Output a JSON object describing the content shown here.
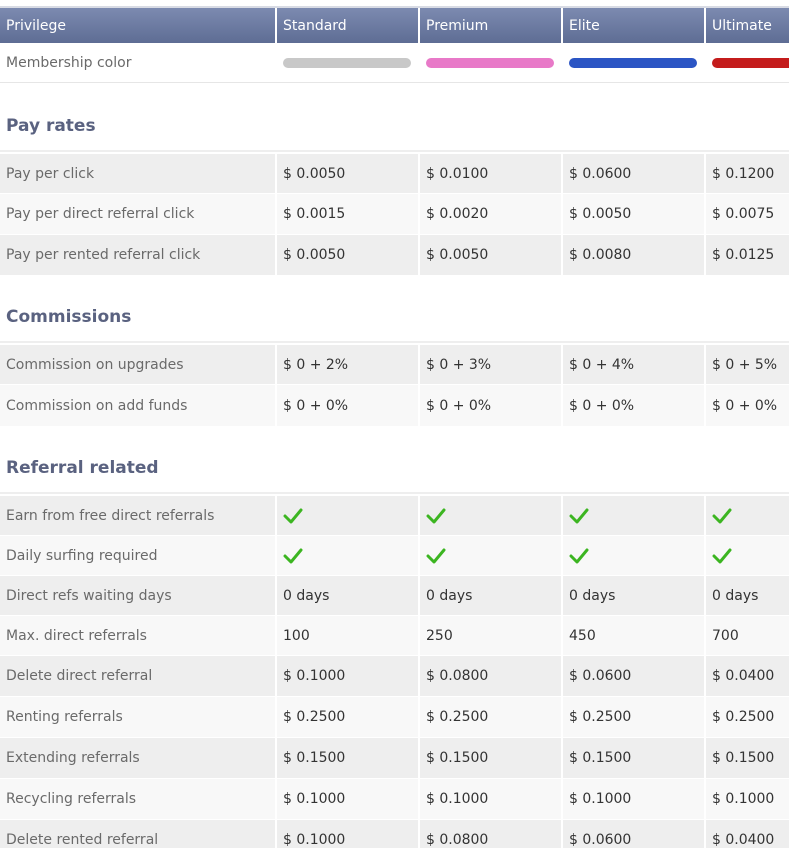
{
  "header": {
    "columns": [
      "Privilege",
      "Standard",
      "Premium",
      "Elite",
      "Ultimate"
    ]
  },
  "membership_color": {
    "label": "Membership color",
    "colors": [
      "#c8c8c8",
      "#e879c8",
      "#2b55c4",
      "#c41c1c"
    ]
  },
  "sections": {
    "pay_rates": {
      "title": "Pay rates",
      "rows": [
        {
          "label": "Pay per click",
          "values": [
            "$ 0.0050",
            "$ 0.0100",
            "$ 0.0600",
            "$ 0.1200"
          ]
        },
        {
          "label": "Pay per direct referral click",
          "values": [
            "$ 0.0015",
            "$ 0.0020",
            "$ 0.0050",
            "$ 0.0075"
          ]
        },
        {
          "label": "Pay per rented referral click",
          "values": [
            "$ 0.0050",
            "$ 0.0050",
            "$ 0.0080",
            "$ 0.0125"
          ]
        }
      ]
    },
    "commissions": {
      "title": "Commissions",
      "rows": [
        {
          "label": "Commission on upgrades",
          "values": [
            "$ 0 + 2%",
            "$ 0 + 3%",
            "$ 0 + 4%",
            "$ 0 + 5%"
          ]
        },
        {
          "label": "Commission on add funds",
          "values": [
            "$ 0 + 0%",
            "$ 0 + 0%",
            "$ 0 + 0%",
            "$ 0 + 0%"
          ]
        }
      ]
    },
    "referral_related": {
      "title": "Referral related",
      "rows": [
        {
          "label": "Earn from free direct referrals",
          "values": [
            "check-icon",
            "check-icon",
            "check-icon",
            "check-icon"
          ]
        },
        {
          "label": "Daily surfing required",
          "values": [
            "check-icon",
            "check-icon",
            "check-icon",
            "check-icon"
          ]
        },
        {
          "label": "Direct refs waiting days",
          "values": [
            "0 days",
            "0 days",
            "0 days",
            "0 days"
          ]
        },
        {
          "label": "Max. direct referrals",
          "values": [
            "100",
            "250",
            "450",
            "700"
          ]
        },
        {
          "label": "Delete direct referral",
          "values": [
            "$ 0.1000",
            "$ 0.0800",
            "$ 0.0600",
            "$ 0.0400"
          ]
        },
        {
          "label": "Renting referrals",
          "values": [
            "$ 0.2500",
            "$ 0.2500",
            "$ 0.2500",
            "$ 0.2500"
          ]
        },
        {
          "label": "Extending referrals",
          "values": [
            "$ 0.1500",
            "$ 0.1500",
            "$ 0.1500",
            "$ 0.1500"
          ]
        },
        {
          "label": "Recycling referrals",
          "values": [
            "$ 0.1000",
            "$ 0.1000",
            "$ 0.1000",
            "$ 0.1000"
          ]
        },
        {
          "label": "Delete rented referral",
          "values": [
            "$ 0.1000",
            "$ 0.0800",
            "$ 0.0600",
            "$ 0.0400"
          ]
        }
      ]
    }
  },
  "check_color": "#3cb521"
}
